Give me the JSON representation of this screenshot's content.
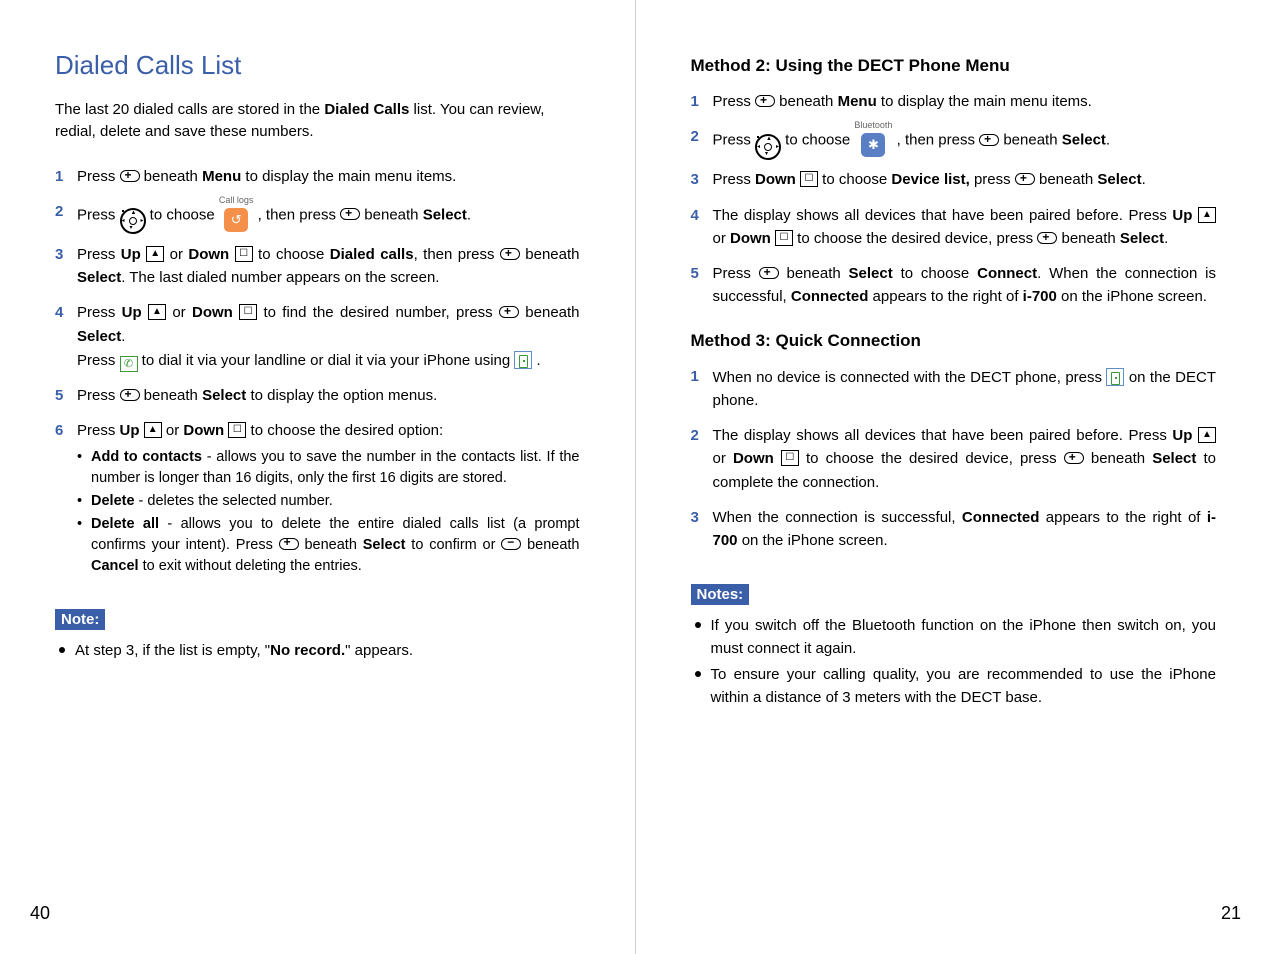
{
  "left": {
    "heading": "Dialed Calls List",
    "intro_a": "The last 20 dialed calls are stored in the ",
    "intro_b": "Dialed Calls",
    "intro_c": " list. You can review, redial, delete and save these numbers.",
    "step1_a": "Press ",
    "step1_b": " beneath ",
    "step1_menu": "Menu",
    "step1_c": " to display the main menu items.",
    "step2_a": "Press ",
    "step2_b": " to choose ",
    "step2_app_label": "Call logs",
    "step2_c": " , then press ",
    "step2_d": " beneath ",
    "step2_select": "Select",
    "step2_e": ".",
    "step3_a": "Press ",
    "step3_up": "Up",
    "step3_b": " or ",
    "step3_down": "Down",
    "step3_c": " to choose ",
    "step3_dialed": "Dialed calls",
    "step3_d": ", then press ",
    "step3_e": " beneath ",
    "step3_select": "Select",
    "step3_f": ". The last dialed number appears on the screen.",
    "step4_a": "Press ",
    "step4_up": "Up",
    "step4_b": " or ",
    "step4_down": "Down",
    "step4_c": " to find the desired number, press ",
    "step4_d": " beneath ",
    "step4_select": "Select",
    "step4_e": ".",
    "step4_line2_a": "Press ",
    "step4_line2_b": " to dial it via your landline or dial it via your iPhone using ",
    "step4_line2_c": " .",
    "step5_a": "Press ",
    "step5_b": " beneath ",
    "step5_select": "Select",
    "step5_c": " to display the option menus.",
    "step6_a": "Press ",
    "step6_up": "Up",
    "step6_b": " or ",
    "step6_down": "Down",
    "step6_c": " to choose the desired option:",
    "step6_b1_title": "Add to contacts",
    "step6_b1_text": " - allows you to save the number in the contacts list. If the number is longer than 16 digits, only the first 16 digits are stored.",
    "step6_b2_title": "Delete",
    "step6_b2_text": " - deletes the selected number.",
    "step6_b3_title": "Delete all",
    "step6_b3_text_a": " - allows you to delete the entire dialed calls list (a prompt confirms your intent). Press ",
    "step6_b3_text_b": " beneath ",
    "step6_b3_select": "Select",
    "step6_b3_text_c": " to confirm or ",
    "step6_b3_text_d": " beneath ",
    "step6_b3_cancel": "Cancel",
    "step6_b3_text_e": " to exit without deleting the entries.",
    "note_label": "Note:",
    "note_text_a": "At step 3, if the list is empty, \"",
    "note_text_b": "No record.",
    "note_text_c": "\" appears.",
    "page_num": "40"
  },
  "right": {
    "method2_title": "Method 2: Using the DECT Phone Menu",
    "m2s1_a": "Press ",
    "m2s1_b": " beneath ",
    "m2s1_menu": "Menu",
    "m2s1_c": " to display the main menu items.",
    "m2s2_a": "Press ",
    "m2s2_b": " to choose ",
    "m2s2_app_label": "Bluetooth",
    "m2s2_c": " , then press ",
    "m2s2_d": " beneath ",
    "m2s2_select": "Select",
    "m2s2_e": ".",
    "m2s3_a": "Press ",
    "m2s3_down": "Down",
    "m2s3_b": " to choose ",
    "m2s3_device": "Device list,",
    "m2s3_c": " press ",
    "m2s3_d": " beneath ",
    "m2s3_select": "Select",
    "m2s3_e": ".",
    "m2s4_a": "The display shows all devices that have been paired before. Press ",
    "m2s4_up": "Up",
    "m2s4_b": " or ",
    "m2s4_down": "Down",
    "m2s4_c": " to choose the desired device, press ",
    "m2s4_d": " beneath ",
    "m2s4_select": "Select",
    "m2s4_e": ".",
    "m2s5_a": "Press ",
    "m2s5_b": " beneath ",
    "m2s5_select": "Select",
    "m2s5_c": " to choose ",
    "m2s5_connect": "Connect",
    "m2s5_d": ". When the connection is successful, ",
    "m2s5_connected": "Connected",
    "m2s5_e": " appears to the right of ",
    "m2s5_model": "i-700",
    "m2s5_f": " on the iPhone screen.",
    "method3_title": "Method 3: Quick Connection",
    "m3s1_a": "When no device is connected with the DECT phone, press ",
    "m3s1_b": " on the DECT phone.",
    "m3s2_a": "The display shows all devices that have been paired before. Press ",
    "m3s2_up": "Up",
    "m3s2_b": " or ",
    "m3s2_down": "Down",
    "m3s2_c": " to choose the desired device, press ",
    "m3s2_d": " beneath ",
    "m3s2_select": "Select",
    "m3s2_e": " to complete the connection.",
    "m3s3_a": "When the connection is successful, ",
    "m3s3_connected": "Connected",
    "m3s3_b": " appears to the right of ",
    "m3s3_model": "i-700",
    "m3s3_c": " on the iPhone screen.",
    "notes_label": "Notes:",
    "note1": "If you switch off the Bluetooth function on the iPhone then switch on, you must connect it again.",
    "note2": "To ensure your calling quality, you are recommended to use the iPhone within a distance of 3 meters with the DECT base.",
    "page_num": "21"
  }
}
